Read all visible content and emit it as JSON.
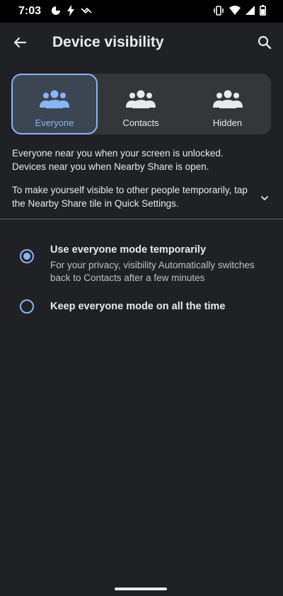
{
  "status_bar": {
    "time": "7:03",
    "left_icons": [
      "pie-notification-icon",
      "flash-icon",
      "data-saver-icon"
    ],
    "right_icons": [
      "vibrate-icon",
      "wifi-icon",
      "signal-icon",
      "battery-icon"
    ]
  },
  "app_bar": {
    "title": "Device visibility",
    "back_icon": "arrow-back-icon",
    "search_icon": "search-icon"
  },
  "visibility_tabs": [
    {
      "label": "Everyone",
      "icon": "people-group-icon",
      "selected": true
    },
    {
      "label": "Contacts",
      "icon": "people-group-icon",
      "selected": false
    },
    {
      "label": "Hidden",
      "icon": "people-group-icon",
      "selected": false
    }
  ],
  "description": {
    "line1": "Everyone near you when your screen is unlocked.",
    "line2": "Devices near you when Nearby Share is open.",
    "hint": "To make yourself visible to other people temporarily, tap the Nearby Share tile in Quick Settings."
  },
  "options": [
    {
      "title": "Use everyone mode temporarily",
      "subtitle": "For your privacy, visibility Automatically switches back to Contacts after a few minutes",
      "selected": true
    },
    {
      "title": "Keep everyone mode on all the time",
      "subtitle": "",
      "selected": false
    }
  ],
  "colors": {
    "background": "#202124",
    "accent": "#8ab4f8",
    "segment_bg": "#35363a",
    "selected_segment_bg": "#3c4652",
    "text_primary": "#e8eaed",
    "text_secondary": "#bdc1c6"
  }
}
